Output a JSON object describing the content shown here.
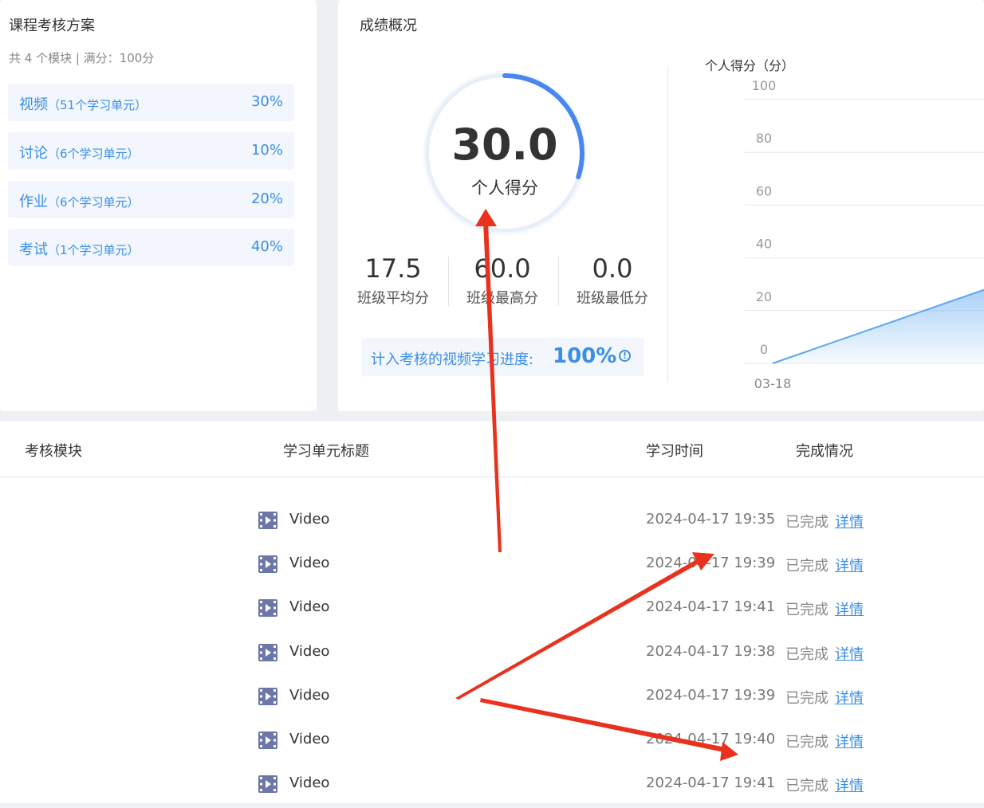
{
  "plan": {
    "title": "课程考核方案",
    "summary": "共 4 个模块 | 满分：100分",
    "modules": [
      {
        "name": "视频",
        "units": "（51个学习单元）",
        "pct": "30%"
      },
      {
        "name": "讨论",
        "units": "（6个学习单元）",
        "pct": "10%"
      },
      {
        "name": "作业",
        "units": "（6个学习单元）",
        "pct": "20%"
      },
      {
        "name": "考试",
        "units": "（1个学习单元）",
        "pct": "40%"
      }
    ]
  },
  "overview": {
    "title": "成绩概况",
    "score": "30.0",
    "score_label": "个人得分",
    "score_fraction": 0.3,
    "stats": [
      {
        "value": "17.5",
        "label": "班级平均分"
      },
      {
        "value": "60.0",
        "label": "班级最高分"
      },
      {
        "value": "0.0",
        "label": "班级最低分"
      }
    ],
    "progress_label": "计入考核的视频学习进度:",
    "progress_value": "100%"
  },
  "chart_data": {
    "type": "area",
    "title": "个人得分（分）",
    "ylim": [
      0,
      100
    ],
    "yticks": [
      0,
      20,
      40,
      60,
      80,
      100
    ],
    "ytick_labels": [
      "0",
      "20",
      "40",
      "60",
      "80",
      "100"
    ],
    "x": [
      "03-18"
    ],
    "series": [
      {
        "values": [
          0
        ]
      }
    ],
    "grid": true,
    "color": "#5aa6f0"
  },
  "table": {
    "headers": [
      "考核模块",
      "学习单元标题",
      "学习时间",
      "完成情况"
    ],
    "rows": [
      {
        "title": "Video",
        "time": "2024-04-17 19:35",
        "status": "已完成",
        "detail": "详情"
      },
      {
        "title": "Video",
        "time": "2024-04-17 19:39",
        "status": "已完成",
        "detail": "详情"
      },
      {
        "title": "Video",
        "time": "2024-04-17 19:41",
        "status": "已完成",
        "detail": "详情"
      },
      {
        "title": "Video",
        "time": "2024-04-17 19:38",
        "status": "已完成",
        "detail": "详情"
      },
      {
        "title": "Video",
        "time": "2024-04-17 19:39",
        "status": "已完成",
        "detail": "详情"
      },
      {
        "title": "Video",
        "time": "2024-04-17 19:40",
        "status": "已完成",
        "detail": "详情"
      },
      {
        "title": "Video",
        "time": "2024-04-17 19:41",
        "status": "已完成",
        "detail": "详情"
      }
    ]
  },
  "colors": {
    "accent": "#3a8ee6",
    "ring": "#4a86f0",
    "annotation": "#e8321e"
  }
}
